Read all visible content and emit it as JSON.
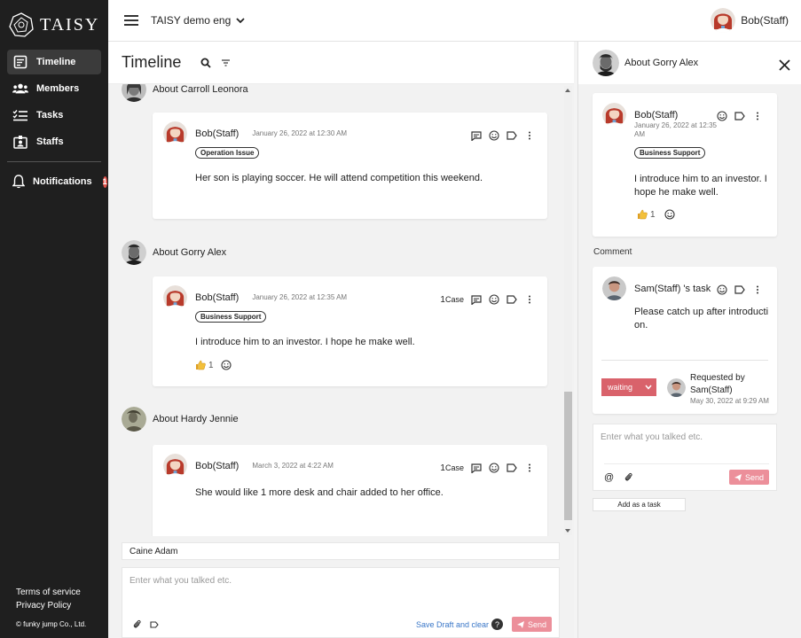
{
  "brand": {
    "name": "TAISY"
  },
  "sidebar": {
    "items": [
      {
        "label": "Timeline",
        "icon": "timeline-icon"
      },
      {
        "label": "Members",
        "icon": "members-icon"
      },
      {
        "label": "Tasks",
        "icon": "tasks-icon"
      },
      {
        "label": "Staffs",
        "icon": "staffs-icon"
      }
    ],
    "notifications": {
      "label": "Notifications",
      "count": "1"
    },
    "footer": {
      "terms": "Terms of service",
      "privacy": "Privacy Policy",
      "copyright": "© funky jump Co., Ltd."
    }
  },
  "topbar": {
    "org": "TAISY demo eng",
    "user": "Bob(Staff)"
  },
  "timeline": {
    "title": "Timeline",
    "groups": [
      {
        "about": "About Carroll Leonora",
        "author": "Bob(Staff)",
        "date": "January 26, 2022 at 12:30 AM",
        "tag": "Operation Issue",
        "body": "Her son is playing soccer. He will attend competition this weekend."
      },
      {
        "about": "About Gorry Alex",
        "author": "Bob(Staff)",
        "date": "January 26, 2022 at 12:35 AM",
        "case_count": "1",
        "case_label": "Case",
        "tag": "Business Support",
        "body": "I introduce him to an investor. I hope he make well.",
        "like_count": "1"
      },
      {
        "about": "About Hardy Jennie",
        "author": "Bob(Staff)",
        "date": "March 3, 2022 at 4:22 AM",
        "case_count": "1",
        "case_label": "Case",
        "body": "She would like 1 more desk and chair added to her office."
      }
    ],
    "composer": {
      "mention": "Caine Adam",
      "placeholder": "Enter what you talked etc.",
      "save_draft": "Save Draft and clear",
      "help": "?",
      "send": "Send"
    }
  },
  "detail": {
    "title": "About Gorry Alex",
    "post": {
      "author": "Bob(Staff)",
      "date_line1": "January 26, 2022 at 12:35",
      "date_line2": "AM",
      "tag": "Business Support",
      "body_line1": "I introduce him to an investor. I",
      "body_line2": "hope he make well.",
      "like_count": "1"
    },
    "comment_label": "Comment",
    "task": {
      "title": "Sam(Staff) 's task",
      "body_line1": "Please catch up after introducti",
      "body_line2": "on.",
      "status": "waiting",
      "requested_by": "Requested by",
      "requester": "Sam(Staff)",
      "requested_date": "May 30, 2022 at 9:29 AM"
    },
    "comment_box": {
      "placeholder": "Enter what you talked etc.",
      "send": "Send"
    },
    "add_task": "Add as a task"
  },
  "colors": {
    "sidebar_bg": "#1f1f1f",
    "send": "#ec8f9a",
    "status": "#d9626b",
    "badge": "#e2534b"
  }
}
